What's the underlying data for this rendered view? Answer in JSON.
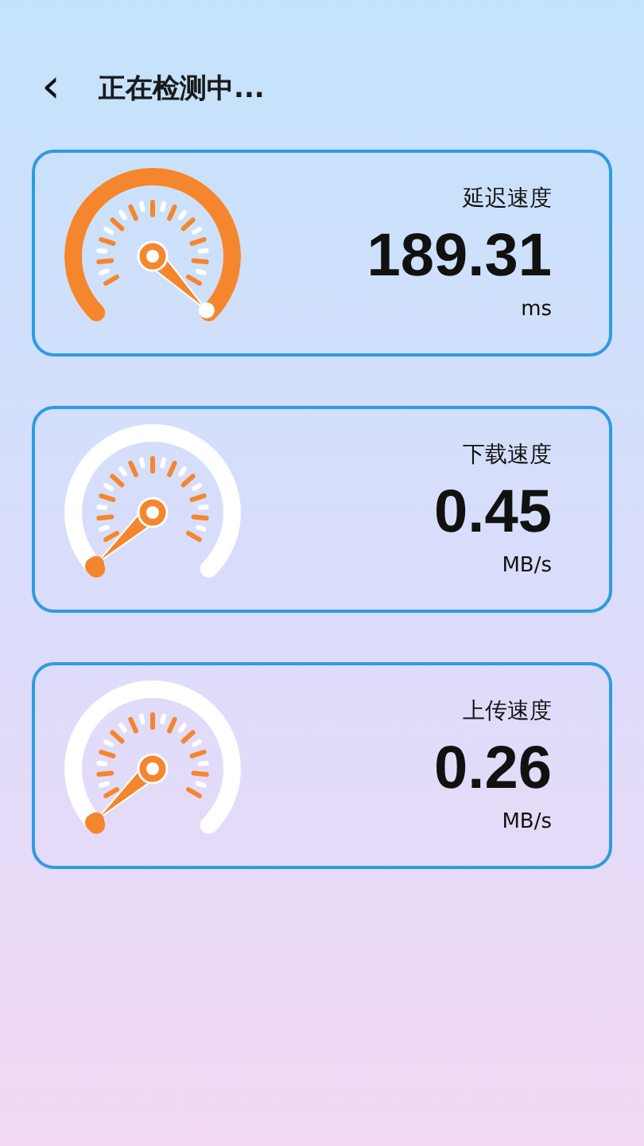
{
  "header": {
    "back": "‹",
    "title": "正在检测中..."
  },
  "metrics": [
    {
      "label": "延迟速度",
      "value": "189.31",
      "unit": "ms",
      "kind": "complete"
    },
    {
      "label": "下载速度",
      "value": "0.45",
      "unit": "MB/s",
      "kind": "pending"
    },
    {
      "label": "上传速度",
      "value": "0.26",
      "unit": "MB/s",
      "kind": "pending"
    }
  ]
}
